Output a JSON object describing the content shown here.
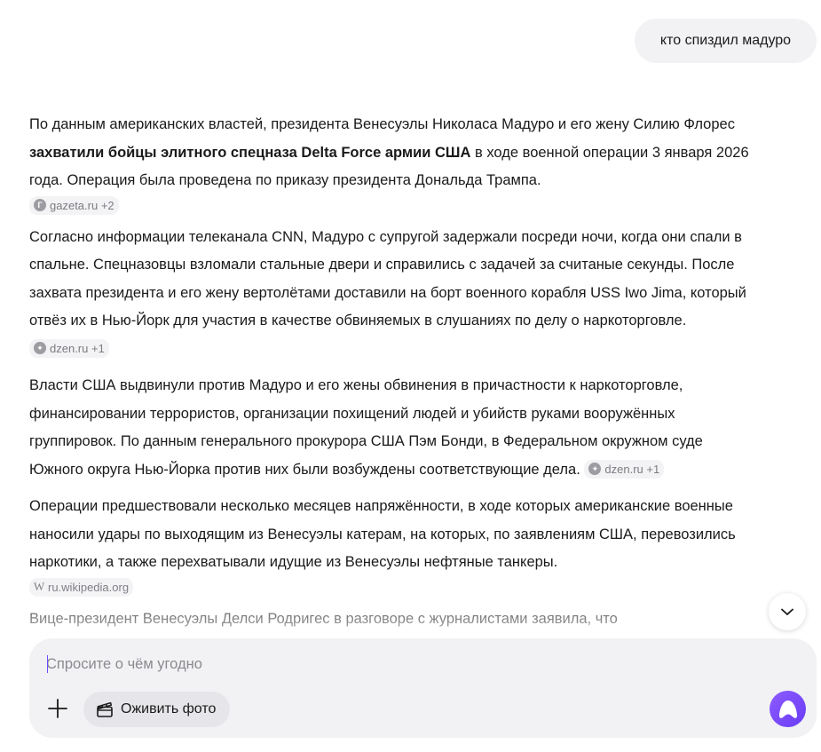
{
  "user_message": "кто спиздил мадуро",
  "answer": {
    "p1_pre": "По данным американских властей, президента Венесуэлы Николаса Мадуро и его жену Силию Флорес ",
    "p1_bold": "захватили бойцы элитного спецназа Delta Force армии США",
    "p1_post": " в ходе военной операции 3 января 2026 года. Операция была проведена по приказу президента Дональда Трампа.",
    "p1_source": "gazeta.ru +2",
    "p2": "Согласно информации телеканала CNN, Мадуро с супругой задержали посреди ночи, когда они спали в спальне. Спецназовцы взломали стальные двери и справились с задачей за считаные секунды. После захвата президента и его жену вертолётами доставили на борт военного корабля USS Iwo Jima, который отвёз их в Нью-Йорк для участия в качестве обвиняемых в слушаниях по делу о наркоторговле.",
    "p2_source": "dzen.ru +1",
    "p3": "Власти США выдвинули против Мадуро и его жены обвинения в причастности к наркоторговле, финансировании террористов, организации похищений людей и убийств руками вооружённых группировок. По данным генерального прокурора США Пэм Бонди, в Федеральном окружном суде Южного округа Нью-Йорка против них были возбуждены соответствующие дела.",
    "p3_source": "dzen.ru +1",
    "p4": "Операции предшествовали несколько месяцев напряжённости, в ходе которых американские военные наносили удары по выходящим из Венесуэлы катерам, на которых, по заявлениям США, перевозились наркотики, а также перехватывали идущие из Венесуэлы нефтяные танкеры.",
    "p4_source": "ru.wikipedia.org",
    "p5": "Вице-президент Венесуэлы Делси Родригес в разговоре с журналистами заявила, что"
  },
  "composer": {
    "placeholder": "Спросите о чём угодно",
    "animate_label": "Оживить фото"
  },
  "icons": {
    "scroll_down": "chevron-down-icon",
    "plus": "plus-icon",
    "clapperboard": "clapperboard-icon",
    "alice": "alice-icon"
  },
  "colors": {
    "accent": "#7b4dff",
    "bubble_bg": "#f2f2f4"
  }
}
